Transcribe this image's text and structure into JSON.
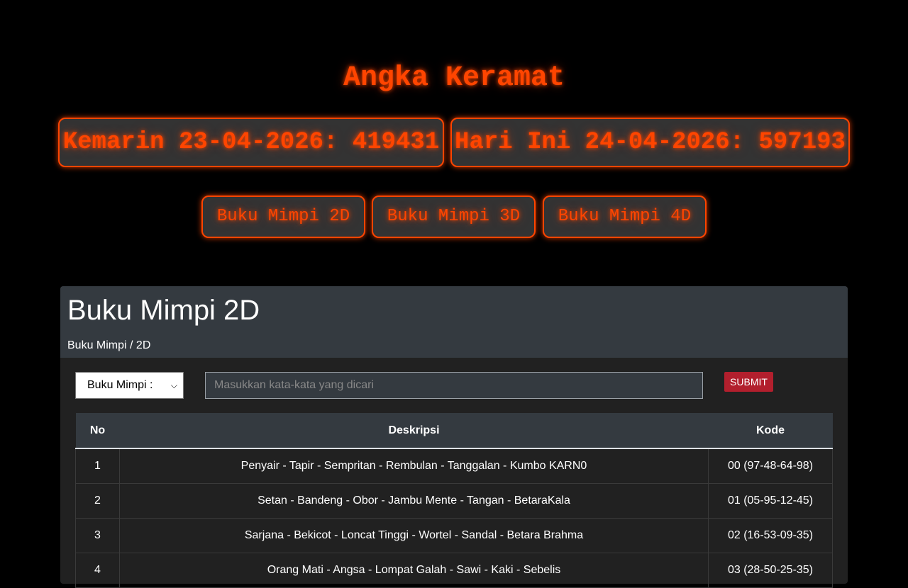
{
  "site_title": "Angka Keramat",
  "numbers": {
    "yesterday": "Kemarin 23-04-2026: 419431",
    "today": "Hari Ini 24-04-2026: 597193"
  },
  "nav": {
    "btn_2d": "Buku Mimpi 2D",
    "btn_3d": "Buku Mimpi 3D",
    "btn_4d": "Buku Mimpi 4D"
  },
  "panel": {
    "title": "Buku Mimpi 2D",
    "breadcrumb": "Buku Mimpi / 2D"
  },
  "search": {
    "select_value": "Buku Mimpi :",
    "placeholder": "Masukkan kata-kata yang dicari",
    "submit_label": "SUBMIT"
  },
  "table": {
    "headers": {
      "no": "No",
      "desc": "Deskripsi",
      "kode": "Kode"
    },
    "rows": [
      {
        "no": "1",
        "desc": "Penyair - Tapir - Sempritan - Rembulan - Tanggalan - Kumbo KARN0",
        "kode": "00 (97-48-64-98)"
      },
      {
        "no": "2",
        "desc": "Setan - Bandeng - Obor - Jambu Mente - Tangan - BetaraKala",
        "kode": "01 (05-95-12-45)"
      },
      {
        "no": "3",
        "desc": "Sarjana - Bekicot - Loncat Tinggi - Wortel - Sandal - Betara Brahma",
        "kode": "02 (16-53-09-35)"
      },
      {
        "no": "4",
        "desc": "Orang Mati - Angsa - Lompat Galah - Sawi - Kaki - Sebelis",
        "kode": "03 (28-50-25-35)"
      }
    ]
  },
  "colors": {
    "accent": "#ff4500",
    "submit": "#b21f2d",
    "panel": "#343a40"
  }
}
